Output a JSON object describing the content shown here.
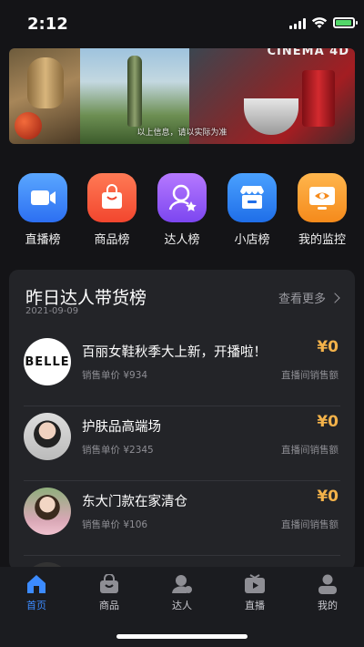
{
  "status_bar": {
    "time": "2:12"
  },
  "banner": {
    "caption": "以上信息，请以实际为准",
    "logo_text": "CINEMA 4D"
  },
  "categories": [
    {
      "label": "直播榜",
      "icon": "video-camera-icon",
      "color": "#2c6ff2"
    },
    {
      "label": "商品榜",
      "icon": "shopping-bag-icon",
      "color": "#f2462e"
    },
    {
      "label": "达人榜",
      "icon": "person-star-icon",
      "color": "#7c46f0"
    },
    {
      "label": "小店榜",
      "icon": "shop-icon",
      "color": "#1f6ee8"
    },
    {
      "label": "我的监控",
      "icon": "monitor-eye-icon",
      "color": "#f58a1b"
    }
  ],
  "ranking": {
    "title": "昨日达人带货榜",
    "date": "2021-09-09",
    "more_label": "查看更多",
    "rows": [
      {
        "avatar_text": "BELLE",
        "name": "百丽女鞋秋季大上新，开播啦！",
        "price": "销售单价 ¥934",
        "amount": "¥0",
        "amount_label": "直播间销售额"
      },
      {
        "avatar_text": "",
        "name": "护肤品高端场",
        "price": "销售单价 ¥2345",
        "amount": "¥0",
        "amount_label": "直播间销售额"
      },
      {
        "avatar_text": "",
        "name": "东大门款在家清仓",
        "price": "销售单价 ¥106",
        "amount": "¥0",
        "amount_label": "直播间销售额"
      }
    ]
  },
  "tabbar": {
    "active_color": "#3c8bff",
    "tabs": [
      {
        "label": "首页",
        "icon": "home-icon"
      },
      {
        "label": "商品",
        "icon": "bag-icon"
      },
      {
        "label": "达人",
        "icon": "person-icon"
      },
      {
        "label": "直播",
        "icon": "tv-play-icon"
      },
      {
        "label": "我的",
        "icon": "profile-icon"
      }
    ]
  }
}
